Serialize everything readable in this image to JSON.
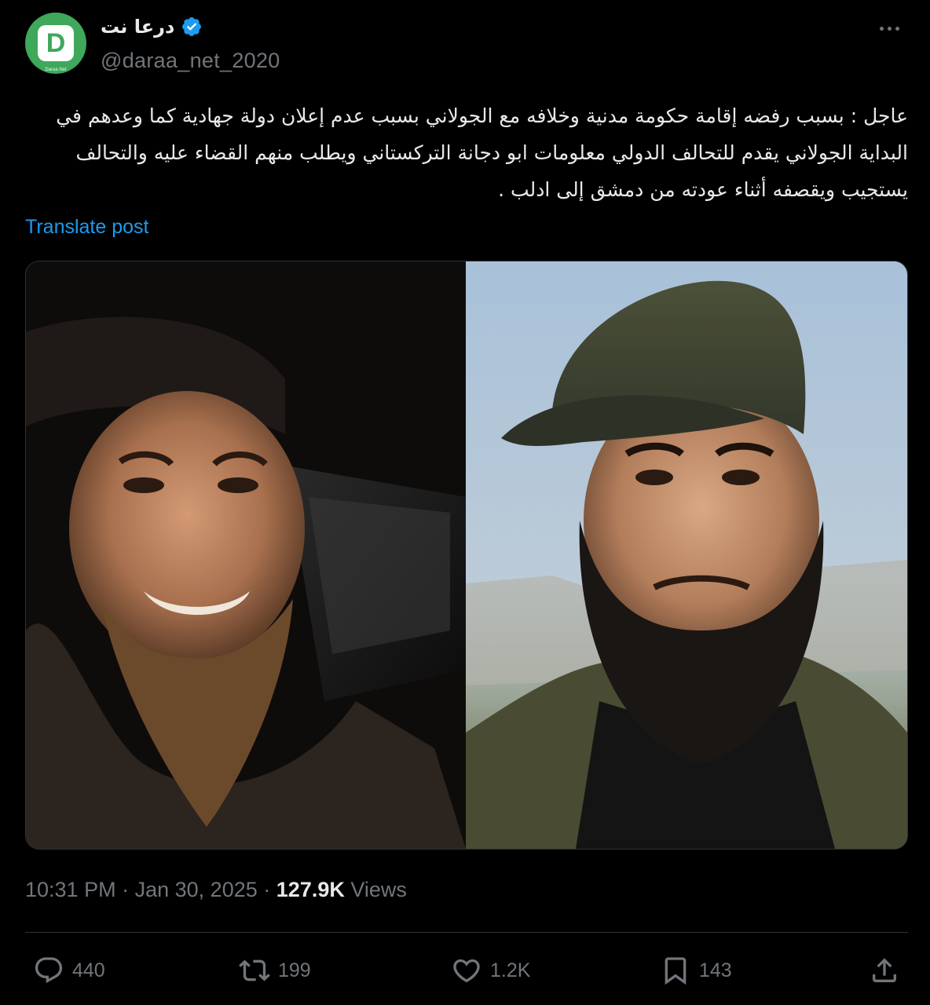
{
  "account": {
    "display_name": "درعا نت",
    "handle": "@daraa_net_2020",
    "avatar_letter": "D",
    "avatar_subtext": "Daraa Net"
  },
  "tweet": {
    "text": "عاجل : بسبب رفضه إقامة حكومة مدنية وخلافه مع الجولاني بسبب عدم إعلان دولة جهادية كما وعدهم في\nالبداية الجولاني يقدم للتحالف الدولي معلومات ابو دجانة التركستاني ويطلب منهم القضاء عليه والتحالف\nيستجيب ويقصفه أثناء عودته من دمشق إلى ادلب .",
    "translate_label": "Translate post"
  },
  "meta": {
    "time": "10:31 PM",
    "separator": "·",
    "date": "Jan 30, 2025",
    "views_count": "127.9K",
    "views_label": "Views"
  },
  "actions": {
    "replies": "440",
    "reposts": "199",
    "likes": "1.2K",
    "bookmarks": "143"
  },
  "icons": {
    "verified": "verified-badge-icon",
    "more": "more-icon",
    "reply": "reply-icon",
    "repost": "repost-icon",
    "like": "like-icon",
    "bookmark": "bookmark-icon",
    "share": "share-icon"
  },
  "colors": {
    "background": "#000000",
    "text": "#e7e9ea",
    "secondary": "#71767b",
    "link": "#1d9bf0",
    "verified": "#1d9bf0",
    "avatar_bg": "#3fa85b"
  }
}
